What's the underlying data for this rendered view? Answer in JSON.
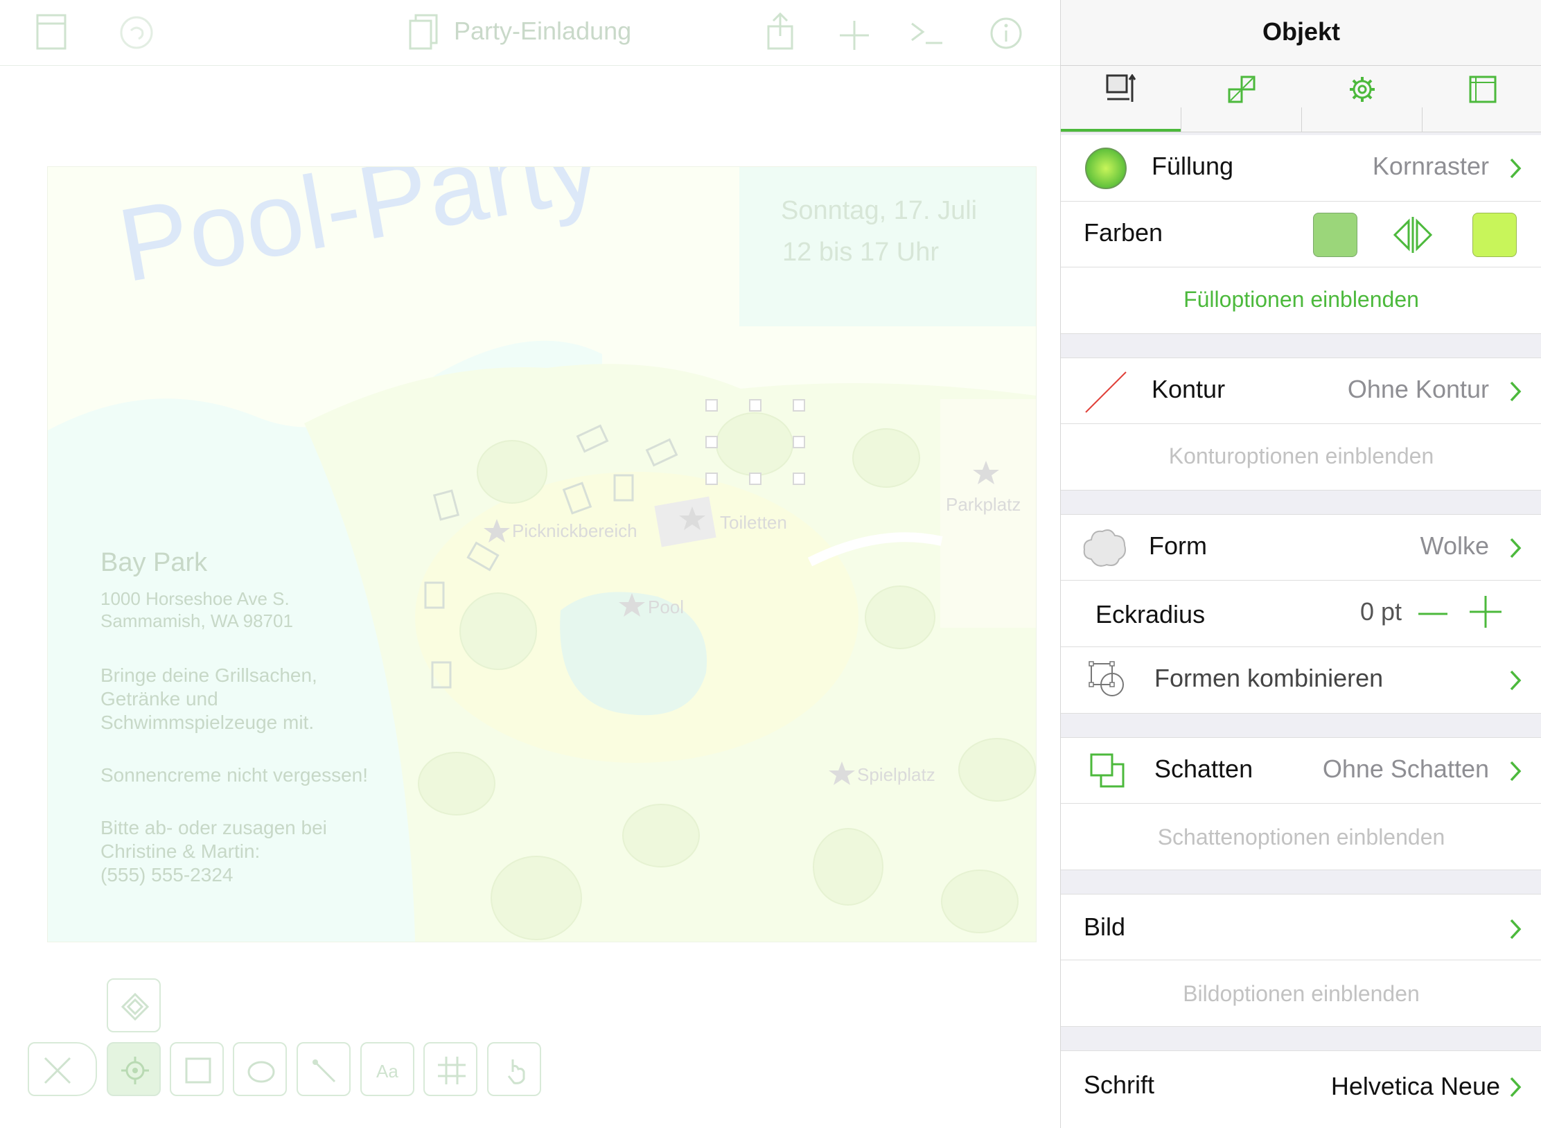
{
  "toolbar": {
    "document_title": "Party-Einladung"
  },
  "canvas": {
    "headline": "Pool-Party",
    "date_line1": "Sonntag, 17. Juli",
    "date_line2": "12 bis 17 Uhr",
    "venue": "Bay Park",
    "address_line1": "1000 Horseshoe Ave S.",
    "address_line2": "Sammamish, WA 98701",
    "note1_line1": "Bringe deine Grillsachen,",
    "note1_line2": "Getränke und",
    "note1_line3": "Schwimmspielzeuge mit.",
    "note2": "Sonnencreme nicht vergessen!",
    "rsvp_line1": "Bitte ab- oder zusagen bei",
    "rsvp_line2": "Christine & Martin:",
    "rsvp_line3": "(555) 555-2324",
    "map_labels": {
      "picnic": "Picknickbereich",
      "toilets": "Toiletten",
      "parking": "Parkplatz",
      "pool": "Pool",
      "playground": "Spielplatz"
    }
  },
  "inspector": {
    "title": "Objekt",
    "fill": {
      "label": "Füllung",
      "value": "Kornraster"
    },
    "colors": {
      "label": "Farben",
      "color_a": "#9bd67a",
      "color_b": "#c8f55a"
    },
    "fill_options": "Fülloptionen einblenden",
    "stroke": {
      "label": "Kontur",
      "value": "Ohne Kontur"
    },
    "stroke_options": "Konturoptionen einblenden",
    "shape": {
      "label": "Form",
      "value": "Wolke"
    },
    "corner_radius": {
      "label": "Eckradius",
      "value": "0 pt"
    },
    "combine_shapes": {
      "label": "Formen kombinieren"
    },
    "shadow": {
      "label": "Schatten",
      "value": "Ohne Schatten"
    },
    "shadow_options": "Schattenoptionen einblenden",
    "image": {
      "label": "Bild"
    },
    "image_options": "Bildoptionen einblenden",
    "font": {
      "label": "Schrift",
      "value": "Helvetica Neue"
    }
  },
  "colors": {
    "accent": "#4cb93c",
    "faint": "#c7d8c7"
  }
}
